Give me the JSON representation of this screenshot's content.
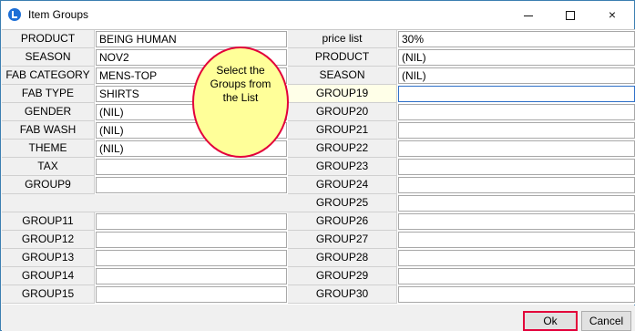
{
  "window": {
    "title": "Item Groups",
    "icon": "app-icon",
    "controls": {
      "minimize": "minimize-icon",
      "maximize": "maximize-icon",
      "close": "×"
    }
  },
  "left": {
    "rows": [
      {
        "label": "PRODUCT",
        "value": "BEING HUMAN"
      },
      {
        "label": "SEASON",
        "value": "NOV2"
      },
      {
        "label": "FAB CATEGORY",
        "value": "MENS-TOP"
      },
      {
        "label": "FAB TYPE",
        "value": "SHIRTS"
      },
      {
        "label": "GENDER",
        "value": "(NIL)"
      },
      {
        "label": "FAB WASH",
        "value": "(NIL)"
      },
      {
        "label": "THEME",
        "value": "(NIL)"
      },
      {
        "label": "TAX",
        "value": ""
      },
      {
        "label": "GROUP9",
        "value": ""
      },
      {
        "label": "",
        "value": ""
      },
      {
        "label": "GROUP11",
        "value": ""
      },
      {
        "label": "GROUP12",
        "value": ""
      },
      {
        "label": "GROUP13",
        "value": ""
      },
      {
        "label": "GROUP14",
        "value": ""
      },
      {
        "label": "GROUP15",
        "value": ""
      }
    ]
  },
  "right": {
    "rows": [
      {
        "label": "price list",
        "value": "30%"
      },
      {
        "label": "PRODUCT",
        "value": "(NIL)"
      },
      {
        "label": "SEASON",
        "value": "(NIL)"
      },
      {
        "label": "GROUP19",
        "value": ""
      },
      {
        "label": "GROUP20",
        "value": ""
      },
      {
        "label": "GROUP21",
        "value": ""
      },
      {
        "label": "GROUP22",
        "value": ""
      },
      {
        "label": "GROUP23",
        "value": ""
      },
      {
        "label": "GROUP24",
        "value": ""
      },
      {
        "label": "GROUP25",
        "value": ""
      },
      {
        "label": "GROUP26",
        "value": ""
      },
      {
        "label": "GROUP27",
        "value": ""
      },
      {
        "label": "GROUP28",
        "value": ""
      },
      {
        "label": "GROUP29",
        "value": ""
      },
      {
        "label": "GROUP30",
        "value": ""
      }
    ]
  },
  "callout": {
    "line1": "Select the",
    "line2": "Groups from",
    "line3": "the List"
  },
  "footer": {
    "ok_label": "Ok",
    "cancel_label": "Cancel"
  },
  "colors": {
    "callout_fill": "#ffff99",
    "callout_border": "#e3003a",
    "active_border": "#2f70c8"
  }
}
